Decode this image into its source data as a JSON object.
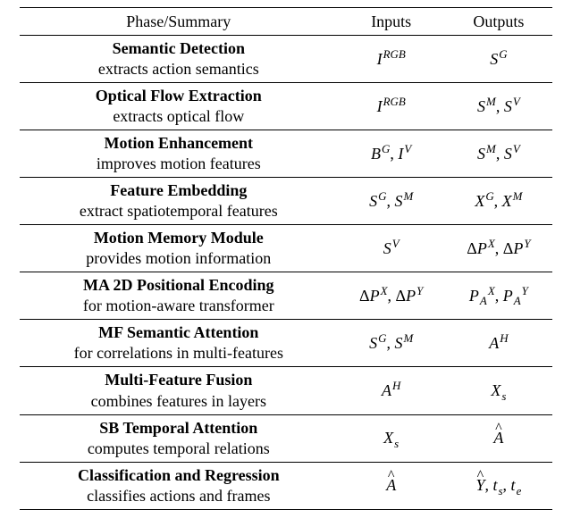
{
  "headers": {
    "phase": "Phase/Summary",
    "inputs": "Inputs",
    "outputs": "Outputs"
  },
  "chart_data": {
    "type": "table",
    "columns": [
      "Phase/Summary title",
      "Phase/Summary description",
      "Inputs",
      "Outputs"
    ],
    "rows": [
      [
        "Semantic Detection",
        "extracts action semantics",
        "I^{RGB}",
        "S^{G}"
      ],
      [
        "Optical Flow Extraction",
        "extracts optical flow",
        "I^{RGB}",
        "S^{M}, S^{V}"
      ],
      [
        "Motion Enhancement",
        "improves motion features",
        "B^{G}, I^{V}",
        "S^{M}, S^{V}"
      ],
      [
        "Feature Embedding",
        "extract spatiotemporal features",
        "S^{G}, S^{M}",
        "X^{G}, X^{M}"
      ],
      [
        "Motion Memory Module",
        "provides motion information",
        "S^{V}",
        "ΔP^{X}, ΔP^{Y}"
      ],
      [
        "MA 2D Positional Encoding",
        "for motion-aware transformer",
        "ΔP^{X}, ΔP^{Y}",
        "P_{A}^{X}, P_{A}^{Y}"
      ],
      [
        "MF Semantic Attention",
        "for correlations in multi-features",
        "S^{G}, S^{M}",
        "A^{H}"
      ],
      [
        "Multi-Feature Fusion",
        "combines features in layers",
        "A^{H}",
        "X_{s}"
      ],
      [
        "SB Temporal Attention",
        "computes temporal relations",
        "X_{s}",
        "Â"
      ],
      [
        "Classification and Regression",
        "classifies actions and frames",
        "Â",
        "Ŷ, t_{s}, t_{e}"
      ]
    ]
  },
  "rows": [
    {
      "title": "Semantic Detection",
      "desc": "extracts action semantics",
      "inputs_html": "<span class='math'>I<sup>RGB</sup></span>",
      "outputs_html": "<span class='math'>S<sup>G</sup></span>"
    },
    {
      "title": "Optical Flow Extraction",
      "desc": "extracts optical flow",
      "inputs_html": "<span class='math'>I<sup>RGB</sup></span>",
      "outputs_html": "<span class='math'>S<sup>M</sup><span class='rm'>, </span>S<sup>V</sup></span>"
    },
    {
      "title": "Motion Enhancement",
      "desc": "improves motion features",
      "inputs_html": "<span class='math'>B<sup>G</sup><span class='rm'>, </span>I<sup>V</sup></span>",
      "outputs_html": "<span class='math'>S<sup>M</sup><span class='rm'>, </span>S<sup>V</sup></span>"
    },
    {
      "title": "Feature Embedding",
      "desc": "extract spatiotemporal features",
      "inputs_html": "<span class='math'>S<sup>G</sup><span class='rm'>, </span>S<sup>M</sup></span>",
      "outputs_html": "<span class='math'>X<sup>G</sup><span class='rm'>, </span>X<sup>M</sup></span>"
    },
    {
      "title": "Motion Memory Module",
      "desc": "provides motion information",
      "inputs_html": "<span class='math'>S<sup>V</sup></span>",
      "outputs_html": "<span class='math'><span class='rm'>Δ</span>P<sup>X</sup><span class='rm'>, Δ</span>P<sup>Y</sup></span>"
    },
    {
      "title": "MA 2D Positional Encoding",
      "desc": "for motion-aware transformer",
      "inputs_html": "<span class='math'><span class='rm'>Δ</span>P<sup>X</sup><span class='rm'>, Δ</span>P<sup>Y</sup></span>",
      "outputs_html": "<span class='math'>P<sub>A</sub><sup>X</sup><span class='rm'>, </span>P<sub>A</sub><sup>Y</sup></span>"
    },
    {
      "title": "MF Semantic Attention",
      "desc": "for correlations in multi-features",
      "inputs_html": "<span class='math'>S<sup>G</sup><span class='rm'>, </span>S<sup>M</sup></span>",
      "outputs_html": "<span class='math'>A<sup>H</sup></span>"
    },
    {
      "title": "Multi-Feature Fusion",
      "desc": "combines features in layers",
      "inputs_html": "<span class='math'>A<sup>H</sup></span>",
      "outputs_html": "<span class='math'>X<sub>s</sub></span>"
    },
    {
      "title": "SB Temporal Attention",
      "desc": "computes temporal relations",
      "inputs_html": "<span class='math'>X<sub>s</sub></span>",
      "outputs_html": "<span class='math'><span class='hat'>A</span></span>"
    },
    {
      "title": "Classification and Regression",
      "desc": "classifies actions and frames",
      "inputs_html": "<span class='math'><span class='hat'>A</span></span>",
      "outputs_html": "<span class='math'><span class='hat'>Y</span><span class='rm'>, </span>t<sub>s</sub><span class='rm'>, </span>t<sub>e</sub></span>"
    }
  ]
}
